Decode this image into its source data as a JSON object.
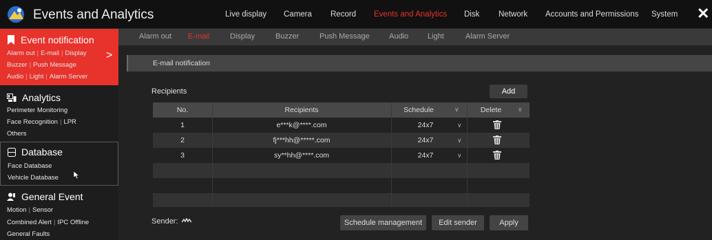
{
  "app": {
    "title": "Events and Analytics",
    "close_label": "✕"
  },
  "top_nav": [
    {
      "label": "Live display"
    },
    {
      "label": "Camera"
    },
    {
      "label": "Record"
    },
    {
      "label": "Events and Analytics",
      "active": true
    },
    {
      "label": "Disk"
    },
    {
      "label": "Network"
    },
    {
      "label": "Accounts and Permissions"
    },
    {
      "label": "System"
    }
  ],
  "sidebar": {
    "event_notification": {
      "title": "Event notification",
      "lines": [
        [
          "Alarm out",
          "E-mail",
          "Display"
        ],
        [
          "Buzzer",
          "Push Message"
        ],
        [
          "Audio",
          "Light",
          "Alarm Server"
        ]
      ]
    },
    "analytics": {
      "title": "Analytics",
      "lines": [
        [
          "Perimeter Monitoring"
        ],
        [
          "Face Recognition",
          "LPR"
        ],
        [
          "Others"
        ]
      ]
    },
    "database": {
      "title": "Database",
      "lines": [
        [
          "Face Database"
        ],
        [
          "Vehicle Database"
        ]
      ]
    },
    "general_event": {
      "title": "General Event",
      "lines": [
        [
          "Motion",
          "Sensor"
        ],
        [
          "Combined Alert",
          "IPC Offline"
        ],
        [
          "General Faults"
        ]
      ]
    }
  },
  "sub_tabs": [
    {
      "label": "Alarm out"
    },
    {
      "label": "E-mail",
      "active": true
    },
    {
      "label": "Display"
    },
    {
      "label": "Buzzer"
    },
    {
      "label": "Push Message"
    },
    {
      "label": "Audio"
    },
    {
      "label": "Light"
    },
    {
      "label": "Alarm Server"
    }
  ],
  "section": {
    "title": "E-mail notification"
  },
  "recipients": {
    "label": "Recipients",
    "add_label": "Add",
    "columns": {
      "no": "No.",
      "recipients": "Recipients",
      "schedule": "Schedule",
      "delete": "Delete"
    },
    "rows": [
      {
        "no": "1",
        "email": "e***k@****.com",
        "schedule": "24x7"
      },
      {
        "no": "2",
        "email": "fj***hh@*****.com",
        "schedule": "24x7"
      },
      {
        "no": "3",
        "email": "sy**hh@****.com",
        "schedule": "24x7"
      }
    ],
    "empty_rows": 3
  },
  "sender": {
    "label": "Sender:"
  },
  "buttons": {
    "schedule": "Schedule management",
    "edit_sender": "Edit sender",
    "apply": "Apply"
  },
  "colors": {
    "accent": "#e8322c",
    "background": "#1a1a1a",
    "panel": "#222222"
  },
  "icons": {
    "logo": "app-logo-icon",
    "bookmark": "bookmark-icon",
    "analytics": "analytics-icon",
    "database": "database-icon",
    "general": "person-alert-icon",
    "trash": "trash-icon"
  }
}
